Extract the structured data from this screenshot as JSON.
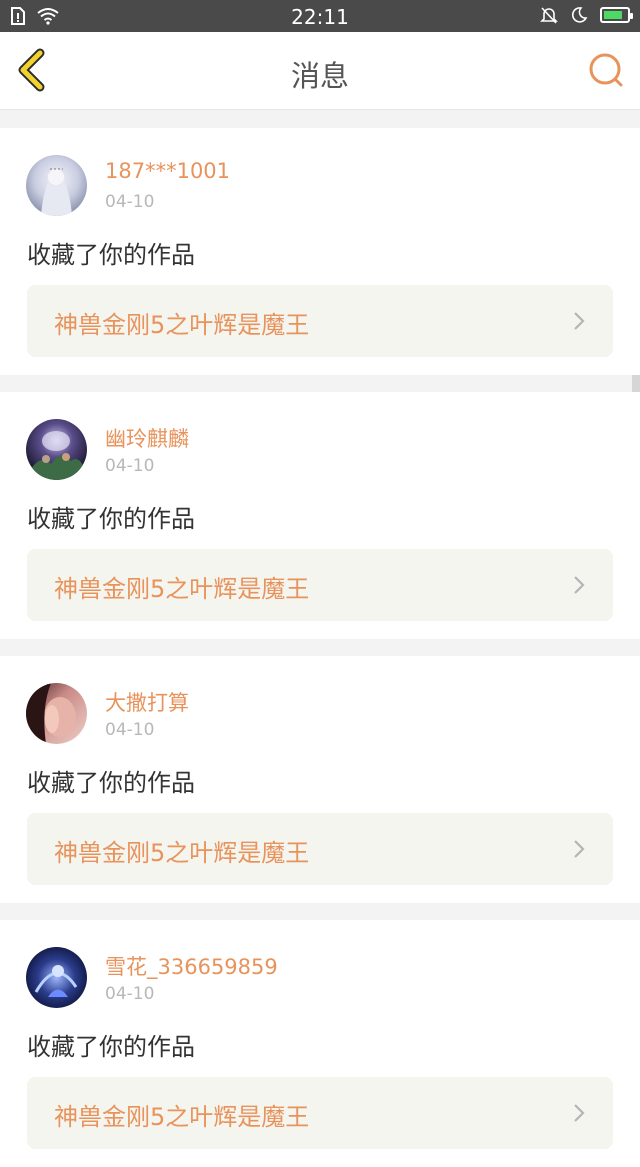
{
  "status_bar": {
    "time": "22:11",
    "icons": [
      "sim-icon",
      "wifi-icon",
      "mute-icon",
      "moon-icon",
      "battery-icon"
    ]
  },
  "header": {
    "title": "消息",
    "back_icon": "chevron-left-icon",
    "search_icon": "search-icon"
  },
  "colors": {
    "accent": "#e8935c",
    "back_icon": "#f1d22e",
    "link_bg": "#f5f5ef"
  },
  "messages": [
    {
      "username": "187***1001",
      "date": "04-10",
      "action": "收藏了你的作品",
      "work_title": "神兽金刚5之叶辉是魔王"
    },
    {
      "username": "幽玲麒麟",
      "date": "04-10",
      "action": "收藏了你的作品",
      "work_title": "神兽金刚5之叶辉是魔王"
    },
    {
      "username": "大撒打算",
      "date": "04-10",
      "action": "收藏了你的作品",
      "work_title": "神兽金刚5之叶辉是魔王"
    },
    {
      "username": "雪花_336659859",
      "date": "04-10",
      "action": "收藏了你的作品",
      "work_title": "神兽金刚5之叶辉是魔王"
    }
  ]
}
